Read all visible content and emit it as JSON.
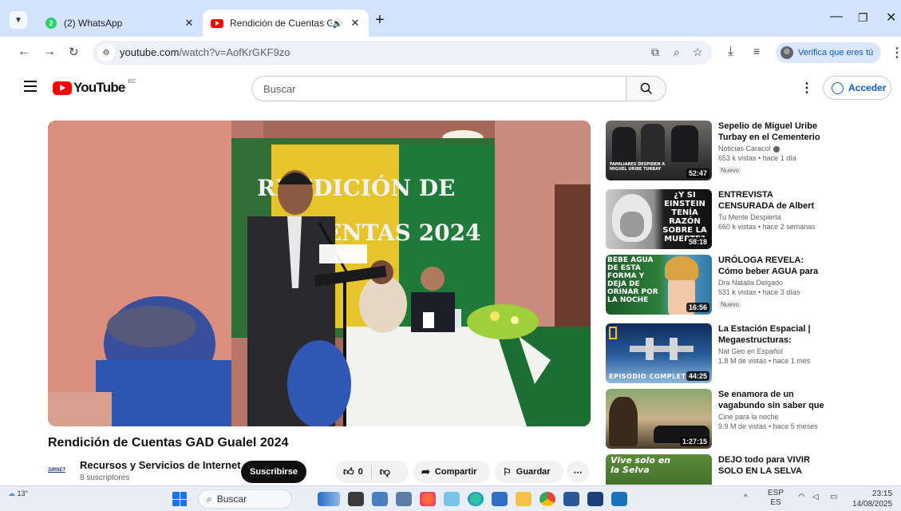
{
  "browser": {
    "tabs": [
      {
        "title": "(2) WhatsApp",
        "badge": "2",
        "active": false
      },
      {
        "title": "Rendición de Cuentas GAD",
        "active": true
      }
    ],
    "address": {
      "host": "youtube.com",
      "path": "/watch?v=AofKrGKF9zo"
    },
    "verify_label": "Verifica que eres tú"
  },
  "youtube": {
    "country_code": "EC",
    "search_placeholder": "Buscar",
    "sign_in": "Acceder"
  },
  "video": {
    "title": "Rendición de Cuentas GAD Gualel 2024",
    "banner_line1": "RENDICIÓN DE",
    "banner_line2": "CUENTAS 2024",
    "channel": {
      "logo_text": "SIRNET",
      "name": "Recursos y Servicios de Internet",
      "subscribers": "8 suscriptores"
    },
    "subscribe_label": "Suscribirse",
    "likes": "0",
    "share_label": "Compartir",
    "save_label": "Guardar"
  },
  "suggestions": [
    {
      "title": "Sepelio de Miguel Uribe Turbay en el Cementerio Central de ...",
      "channel": "Noticias Caracol",
      "verified": true,
      "meta": "653 k vistas • hace 1 día",
      "badge": "Nuevo",
      "duration": "52:47",
      "overlay": "FAMILIARES DESPIDEN A MIGUEL URIBE TURBAY"
    },
    {
      "title": "ENTREVISTA CENSURADA de Albert Einstein Sobre la Vida ...",
      "channel": "Tu Mente Despierta",
      "verified": false,
      "meta": "660 k vistas • hace 2 semanas",
      "badge": "",
      "duration": "58:18",
      "overlay": "¿Y SI EINSTEIN TENÍA RAZÓN SOBRE LA MUERTE?"
    },
    {
      "title": "URÓLOGA REVELA: Cómo beber AGUA para NO LEVANTARTE d...",
      "channel": "Dra Natalia Delgado",
      "verified": false,
      "meta": "531 k vistas • hace 3 días",
      "badge": "Nuevo",
      "duration": "16:56",
      "overlay": "BEBE AGUA DE ESTA FORMA Y DEJA DE ORINAR POR LA NOCHE"
    },
    {
      "title": "La Estación Espacial | Megaestructuras: Maravillas d...",
      "channel": "Nat Geo en Español",
      "verified": false,
      "meta": "1.8 M de vistas • hace 1 mes",
      "badge": "",
      "duration": "44:25",
      "overlay": "EPISODIO COMPLETO"
    },
    {
      "title": "Se enamora de un vagabundo sin saber que es millonario | ...",
      "channel": "Cine para la noche",
      "verified": false,
      "meta": "9.9 M de vistas • hace 5 meses",
      "badge": "",
      "duration": "1:27:15",
      "overlay": ""
    },
    {
      "title": "DEJO todo para VIVIR SOLO EN LA SELVA cuidando animales ...",
      "channel": "",
      "verified": false,
      "meta": "",
      "badge": "",
      "duration": "",
      "overlay": "Vive solo en la Selva"
    }
  ],
  "taskbar": {
    "temperature": "13°",
    "search_placeholder": "Buscar",
    "lang_top": "ESP",
    "lang_bottom": "ES",
    "time": "23:15",
    "date": "14/08/2025"
  }
}
